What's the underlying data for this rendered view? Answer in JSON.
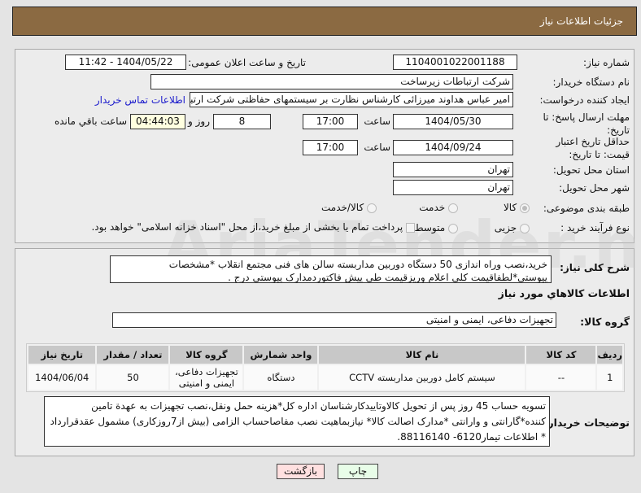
{
  "header": {
    "title": "جزئیات اطلاعات نیاز"
  },
  "form": {
    "need_number_label": "شماره نیاز:",
    "need_number": "1104001022001188",
    "announce_label": "تاریخ و ساعت اعلان عمومی:",
    "announce_value": "1404/05/22 - 11:42",
    "buyer_org_label": "نام دستگاه خریدار:",
    "buyer_org": "شرکت ارتباطات زیرساخت",
    "creator_label": "ایجاد کننده درخواست:",
    "creator": "امیر عباس هداوند میرزائی کارشناس نظارت بر سیستمهای حفاظتی شرکت ارتبا",
    "contact_link": "اطلاعات تماس خریدار",
    "deadline_label": "مهلت ارسال پاسخ: تا تاریخ:",
    "deadline_date": "1404/05/30",
    "time_label": "ساعت",
    "deadline_time": "17:00",
    "days": "8",
    "days_label": "روز و",
    "remaining": "04:44:03",
    "remaining_label": "ساعت باقي مانده",
    "validity_label": "حداقل تاریخ اعتبار قیمت: تا تاریخ:",
    "validity_date": "1404/09/24",
    "validity_time": "17:00",
    "province_label": "استان محل تحویل:",
    "province": "تهران",
    "city_label": "شهر محل تحویل:",
    "city": "تهران",
    "category_label": "طبقه بندی موضوعی:",
    "category_options": [
      "کالا",
      "خدمت",
      "کالا/خدمت"
    ],
    "category_selected": "کالا",
    "process_label": "نوع فرآیند خرید :",
    "process_options": [
      "جزیی",
      "متوسط"
    ],
    "payment_note": "پرداخت تمام یا بخشی از مبلغ خرید،از محل \"اسناد خزانه اسلامی\" خواهد بود."
  },
  "description": {
    "label": "شرح کلی نیاز:",
    "text": "خرید،نصب وراه اندازی 50 دستگاه دوربین مداربسته سالن های فنی مجتمع انقلاب *مشخصات پیوستی*لطفاقیمت کلی اعلام وریزقیمت طی پیش فاکتوردمدارک پیوستی درج ."
  },
  "goods": {
    "section_title": "اطلاعات کالاهاي مورد نیاز",
    "group_label": "گروه کالا:",
    "group_value": "تجهیزات دفاعی، ایمنی و امنیتی",
    "columns": [
      "ردیف",
      "کد کالا",
      "نام کالا",
      "واحد شمارش",
      "گروه کالا",
      "تعداد / مقدار",
      "تاریخ نیاز"
    ],
    "rows": [
      [
        "1",
        "--",
        "سیستم کامل دوربین مداربسته CCTV",
        "دستگاه",
        "تجهیزات دفاعی، ایمنی و امنیتی",
        "50",
        "1404/06/04"
      ]
    ]
  },
  "notes": {
    "label": "توضیحات خریدار:",
    "text": "تسویه حساب 45 روز پس از  تحویل کالاوتاییدکارشناسان اداره کل*هزینه حمل ونقل،نصب تجهیزات به عهدة تامین کننده*گارانتی و وارانتی *مدارک اصالت کالا* نیازبماهیت نصب مفاصاحساب الزامی (بیش از7روزکاری) مشمول عقدقرارداد * اطلاعات تیمار6120- 88116140."
  },
  "buttons": {
    "print": "چاپ",
    "back": "بازگشت"
  },
  "colors": {
    "header": "#8b6a42",
    "link": "#1a1acc",
    "remaining_bg": "#ffffe0"
  }
}
